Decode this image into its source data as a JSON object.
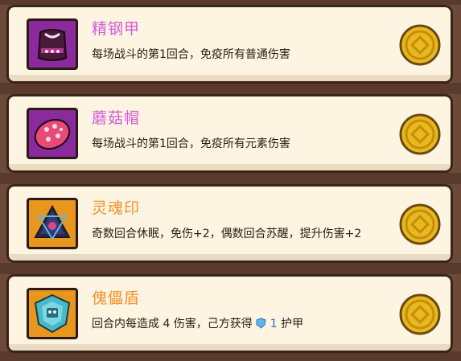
{
  "colors": {
    "title_purple": "#d45ad6",
    "title_orange": "#f0922a",
    "icon_bg_purple": "#8a2a9c",
    "icon_bg_orange": "#e8961e"
  },
  "items": [
    {
      "name": "精钢甲",
      "desc": "每场战斗的第1回合，免疫所有普通伤害",
      "icon": "armor-icon",
      "rarity": "purple"
    },
    {
      "name": "蘑菇帽",
      "desc": "每场战斗的第1回合，免疫所有元素伤害",
      "icon": "mushroom-cap-icon",
      "rarity": "purple"
    },
    {
      "name": "灵魂印",
      "desc": "奇数回合休眠，免伤+2，偶数回合苏醒，提升伤害+2",
      "icon": "soul-seal-icon",
      "rarity": "orange"
    },
    {
      "name": "傀儡盾",
      "desc_prefix": "回合内每造成 4 伤害，己方获得",
      "shield_value": "1",
      "desc_suffix": "护甲",
      "icon": "golem-shield-icon",
      "rarity": "orange"
    }
  ],
  "price_icon": "gold-coin-icon"
}
